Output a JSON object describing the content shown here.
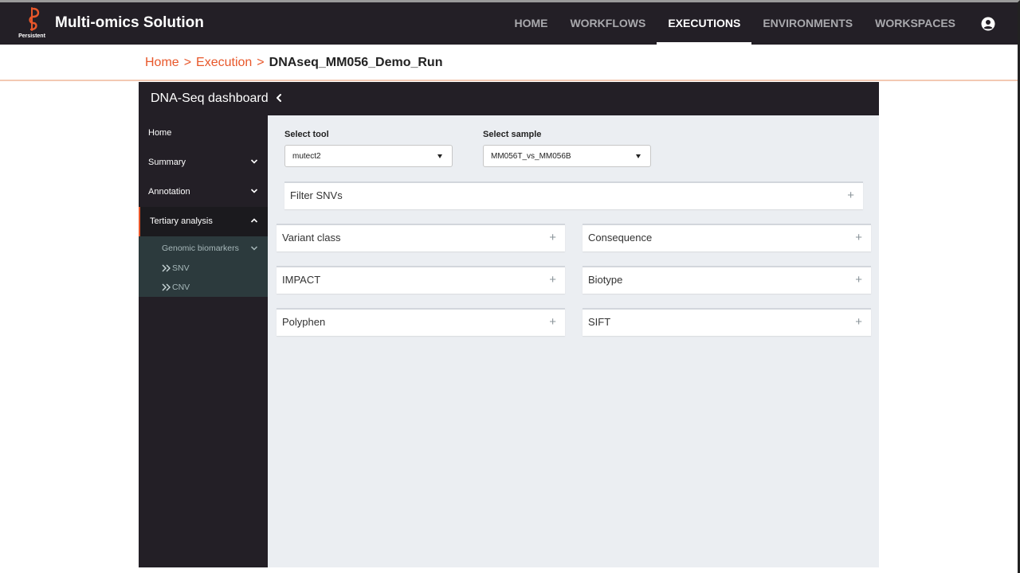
{
  "app": {
    "brand_label": "Persistent",
    "title": "Multi-omics Solution"
  },
  "nav": {
    "items": [
      {
        "label": "HOME"
      },
      {
        "label": "WORKFLOWS"
      },
      {
        "label": "EXECUTIONS",
        "active": true
      },
      {
        "label": "ENVIRONMENTS"
      },
      {
        "label": "WORKSPACES"
      }
    ],
    "account_icon": "account-circle-icon"
  },
  "breadcrumb": {
    "items": [
      "Home",
      "Execution"
    ],
    "separator": ">",
    "current": "DNAseq_MM056_Demo_Run"
  },
  "dashboard": {
    "title": "DNA-Seq dashboard",
    "collapse_icon": "chevron-left-icon"
  },
  "sidebar": {
    "items": [
      {
        "label": "Home"
      },
      {
        "label": "Summary",
        "icon": "chevron-down-icon"
      },
      {
        "label": "Annotation",
        "icon": "chevron-down-icon"
      },
      {
        "label": "Tertiary analysis",
        "icon": "chevron-up-icon",
        "active": true
      }
    ],
    "sub": {
      "group": "Genomic biomarkers",
      "items": [
        "SNV",
        "CNV"
      ],
      "item_icon": "double-chevron-right-icon"
    }
  },
  "filters": {
    "tool_label": "Select tool",
    "tool_value": "mutect2",
    "sample_label": "Select sample",
    "sample_value": "MM056T_vs_MM056B"
  },
  "panels": {
    "filter_snvs": "Filter SNVs",
    "variant_class": "Variant class",
    "consequence": "Consequence",
    "impact": "IMPACT",
    "biotype": "Biotype",
    "polyphen": "Polyphen",
    "sift": "SIFT",
    "expand_symbol": "+"
  },
  "colors": {
    "header_bg": "#231f26",
    "accent": "#e8572a",
    "content_bg": "#ebeef2",
    "subpanel_bg": "#2c3a3d"
  }
}
